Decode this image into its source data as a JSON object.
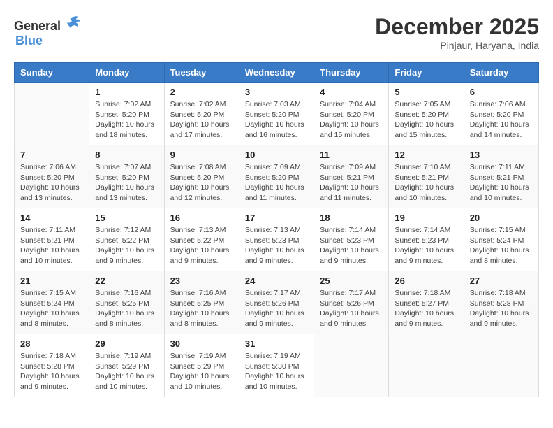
{
  "header": {
    "logo_general": "General",
    "logo_blue": "Blue",
    "month_title": "December 2025",
    "location": "Pinjaur, Haryana, India"
  },
  "weekdays": [
    "Sunday",
    "Monday",
    "Tuesday",
    "Wednesday",
    "Thursday",
    "Friday",
    "Saturday"
  ],
  "weeks": [
    [
      {
        "day": "",
        "info": ""
      },
      {
        "day": "1",
        "info": "Sunrise: 7:02 AM\nSunset: 5:20 PM\nDaylight: 10 hours\nand 18 minutes."
      },
      {
        "day": "2",
        "info": "Sunrise: 7:02 AM\nSunset: 5:20 PM\nDaylight: 10 hours\nand 17 minutes."
      },
      {
        "day": "3",
        "info": "Sunrise: 7:03 AM\nSunset: 5:20 PM\nDaylight: 10 hours\nand 16 minutes."
      },
      {
        "day": "4",
        "info": "Sunrise: 7:04 AM\nSunset: 5:20 PM\nDaylight: 10 hours\nand 15 minutes."
      },
      {
        "day": "5",
        "info": "Sunrise: 7:05 AM\nSunset: 5:20 PM\nDaylight: 10 hours\nand 15 minutes."
      },
      {
        "day": "6",
        "info": "Sunrise: 7:06 AM\nSunset: 5:20 PM\nDaylight: 10 hours\nand 14 minutes."
      }
    ],
    [
      {
        "day": "7",
        "info": "Sunrise: 7:06 AM\nSunset: 5:20 PM\nDaylight: 10 hours\nand 13 minutes."
      },
      {
        "day": "8",
        "info": "Sunrise: 7:07 AM\nSunset: 5:20 PM\nDaylight: 10 hours\nand 13 minutes."
      },
      {
        "day": "9",
        "info": "Sunrise: 7:08 AM\nSunset: 5:20 PM\nDaylight: 10 hours\nand 12 minutes."
      },
      {
        "day": "10",
        "info": "Sunrise: 7:09 AM\nSunset: 5:20 PM\nDaylight: 10 hours\nand 11 minutes."
      },
      {
        "day": "11",
        "info": "Sunrise: 7:09 AM\nSunset: 5:21 PM\nDaylight: 10 hours\nand 11 minutes."
      },
      {
        "day": "12",
        "info": "Sunrise: 7:10 AM\nSunset: 5:21 PM\nDaylight: 10 hours\nand 10 minutes."
      },
      {
        "day": "13",
        "info": "Sunrise: 7:11 AM\nSunset: 5:21 PM\nDaylight: 10 hours\nand 10 minutes."
      }
    ],
    [
      {
        "day": "14",
        "info": "Sunrise: 7:11 AM\nSunset: 5:21 PM\nDaylight: 10 hours\nand 10 minutes."
      },
      {
        "day": "15",
        "info": "Sunrise: 7:12 AM\nSunset: 5:22 PM\nDaylight: 10 hours\nand 9 minutes."
      },
      {
        "day": "16",
        "info": "Sunrise: 7:13 AM\nSunset: 5:22 PM\nDaylight: 10 hours\nand 9 minutes."
      },
      {
        "day": "17",
        "info": "Sunrise: 7:13 AM\nSunset: 5:23 PM\nDaylight: 10 hours\nand 9 minutes."
      },
      {
        "day": "18",
        "info": "Sunrise: 7:14 AM\nSunset: 5:23 PM\nDaylight: 10 hours\nand 9 minutes."
      },
      {
        "day": "19",
        "info": "Sunrise: 7:14 AM\nSunset: 5:23 PM\nDaylight: 10 hours\nand 9 minutes."
      },
      {
        "day": "20",
        "info": "Sunrise: 7:15 AM\nSunset: 5:24 PM\nDaylight: 10 hours\nand 8 minutes."
      }
    ],
    [
      {
        "day": "21",
        "info": "Sunrise: 7:15 AM\nSunset: 5:24 PM\nDaylight: 10 hours\nand 8 minutes."
      },
      {
        "day": "22",
        "info": "Sunrise: 7:16 AM\nSunset: 5:25 PM\nDaylight: 10 hours\nand 8 minutes."
      },
      {
        "day": "23",
        "info": "Sunrise: 7:16 AM\nSunset: 5:25 PM\nDaylight: 10 hours\nand 8 minutes."
      },
      {
        "day": "24",
        "info": "Sunrise: 7:17 AM\nSunset: 5:26 PM\nDaylight: 10 hours\nand 9 minutes."
      },
      {
        "day": "25",
        "info": "Sunrise: 7:17 AM\nSunset: 5:26 PM\nDaylight: 10 hours\nand 9 minutes."
      },
      {
        "day": "26",
        "info": "Sunrise: 7:18 AM\nSunset: 5:27 PM\nDaylight: 10 hours\nand 9 minutes."
      },
      {
        "day": "27",
        "info": "Sunrise: 7:18 AM\nSunset: 5:28 PM\nDaylight: 10 hours\nand 9 minutes."
      }
    ],
    [
      {
        "day": "28",
        "info": "Sunrise: 7:18 AM\nSunset: 5:28 PM\nDaylight: 10 hours\nand 9 minutes."
      },
      {
        "day": "29",
        "info": "Sunrise: 7:19 AM\nSunset: 5:29 PM\nDaylight: 10 hours\nand 10 minutes."
      },
      {
        "day": "30",
        "info": "Sunrise: 7:19 AM\nSunset: 5:29 PM\nDaylight: 10 hours\nand 10 minutes."
      },
      {
        "day": "31",
        "info": "Sunrise: 7:19 AM\nSunset: 5:30 PM\nDaylight: 10 hours\nand 10 minutes."
      },
      {
        "day": "",
        "info": ""
      },
      {
        "day": "",
        "info": ""
      },
      {
        "day": "",
        "info": ""
      }
    ]
  ]
}
